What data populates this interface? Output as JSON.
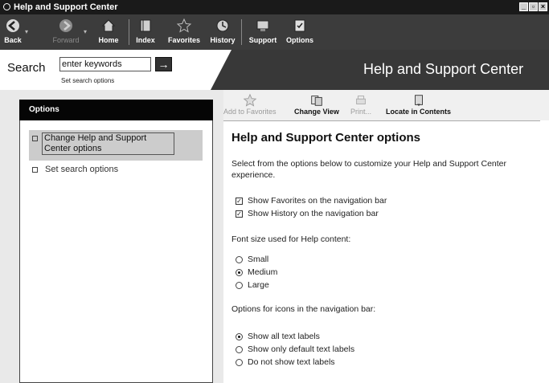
{
  "window": {
    "title": "Help and Support Center",
    "controls": [
      "_",
      "▫",
      "×"
    ]
  },
  "toolbar": {
    "back": "Back",
    "forward": "Forward",
    "home": "Home",
    "index": "Index",
    "favorites": "Favorites",
    "history": "History",
    "support": "Support",
    "options": "Options"
  },
  "search": {
    "label": "Search",
    "value": "enter keywords",
    "go": "→",
    "options_link": "Set search options"
  },
  "banner": {
    "title": "Help and Support Center"
  },
  "left_panel": {
    "header": "Options",
    "items": [
      {
        "label": "Change Help and Support Center options"
      },
      {
        "label": "Set search options"
      }
    ]
  },
  "content_toolbar": {
    "add_to_favorites": "Add to Favorites",
    "change_view": "Change View",
    "print": "Print...",
    "locate": "Locate in Contents"
  },
  "content": {
    "title": "Help and Support Center options",
    "intro_line1": "Select from the options below to customize your Help and Support Center",
    "intro_line2": "experience.",
    "checkboxes": [
      {
        "label": "Show Favorites on the navigation bar",
        "checked": true
      },
      {
        "label": "Show History on the navigation bar",
        "checked": true
      }
    ],
    "font_size_heading": "Font size used for Help content:",
    "font_sizes": [
      {
        "label": "Small",
        "selected": false
      },
      {
        "label": "Medium",
        "selected": true
      },
      {
        "label": "Large",
        "selected": false
      }
    ],
    "icons_heading": "Options for icons in the navigation bar:",
    "icon_options": [
      {
        "label": "Show all text labels",
        "selected": true
      },
      {
        "label": "Show only default text labels",
        "selected": false
      },
      {
        "label": "Do not show text labels",
        "selected": false
      }
    ]
  }
}
